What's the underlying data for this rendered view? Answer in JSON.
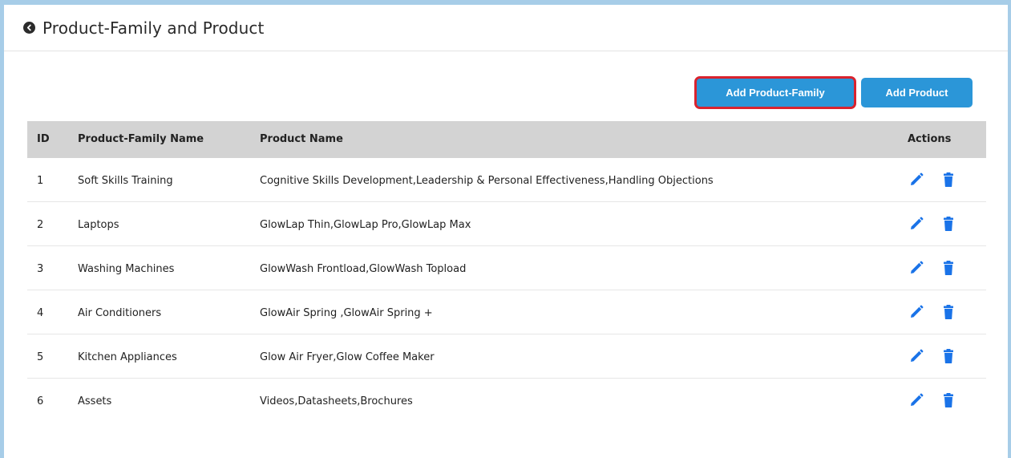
{
  "header": {
    "title": "Product-Family and Product",
    "back_icon": "back-arrow-circle-icon"
  },
  "toolbar": {
    "add_family_label": "Add Product-Family",
    "add_product_label": "Add Product"
  },
  "table": {
    "columns": {
      "id": "ID",
      "family": "Product-Family Name",
      "product": "Product Name",
      "actions": "Actions"
    },
    "rows": [
      {
        "id": "1",
        "family": "Soft Skills Training",
        "product": "Cognitive Skills Development,Leadership & Personal Effectiveness,Handling Objections"
      },
      {
        "id": "2",
        "family": "Laptops",
        "product": "GlowLap Thin,GlowLap Pro,GlowLap Max"
      },
      {
        "id": "3",
        "family": "Washing Machines",
        "product": "GlowWash Frontload,GlowWash Topload"
      },
      {
        "id": "4",
        "family": "Air Conditioners",
        "product": "GlowAir Spring ,GlowAir Spring +"
      },
      {
        "id": "5",
        "family": "Kitchen Appliances",
        "product": "Glow Air Fryer,Glow Coffee Maker"
      },
      {
        "id": "6",
        "family": "Assets",
        "product": "Videos,Datasheets,Brochures"
      }
    ],
    "row_actions": [
      "edit-pencil-icon",
      "delete-trash-icon"
    ]
  },
  "colors": {
    "accent": "#2b96d8",
    "highlight": "#d9232e",
    "header_bg": "#d3d3d3",
    "icon": "#1a73e8"
  }
}
